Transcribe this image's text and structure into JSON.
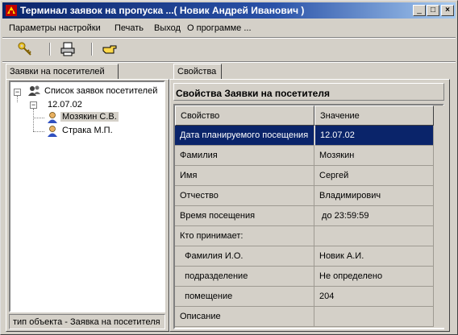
{
  "window": {
    "title": "Терминал заявок на пропуска ...( Новик Андрей Иванович )",
    "minimize": "_",
    "maximize": "□",
    "close": "×"
  },
  "menu": [
    "Параметры настройки",
    "Печать",
    "Выход",
    "О программе ..."
  ],
  "toolbar": {
    "icons": [
      "key-icon",
      "printer-icon",
      "pointing-hand-icon"
    ]
  },
  "left_tab": "Заявки на посетителей",
  "tree": {
    "root": "Список заявок посетителей",
    "date": "12.07.02",
    "items": [
      "Мозякин С.В.",
      "Страка М.П."
    ],
    "selected_index": 0
  },
  "status": "тип объекта - Заявка на посетителя",
  "right_tab": "Свойства",
  "props": {
    "title": "Свойства Заявки на посетителя",
    "col_property": "Свойство",
    "col_value": "Значение",
    "rows": [
      {
        "prop": "Дата планируемого посещения",
        "value": "12.07.02",
        "selected": true
      },
      {
        "prop": "Фамилия",
        "value": "Мозякин"
      },
      {
        "prop": "Имя",
        "value": "Сергей"
      },
      {
        "prop": "Отчество",
        "value": "Владимирович"
      },
      {
        "prop": "Время посещения",
        "value": " до 23:59:59"
      },
      {
        "prop": "Кто принимает:",
        "value": ""
      },
      {
        "prop": "  Фамилия И.О.",
        "value": "Новик А.И."
      },
      {
        "prop": "  подразделение",
        "value": "Не определено"
      },
      {
        "prop": "  помещение",
        "value": "204"
      },
      {
        "prop": "Описание",
        "value": ""
      }
    ]
  }
}
